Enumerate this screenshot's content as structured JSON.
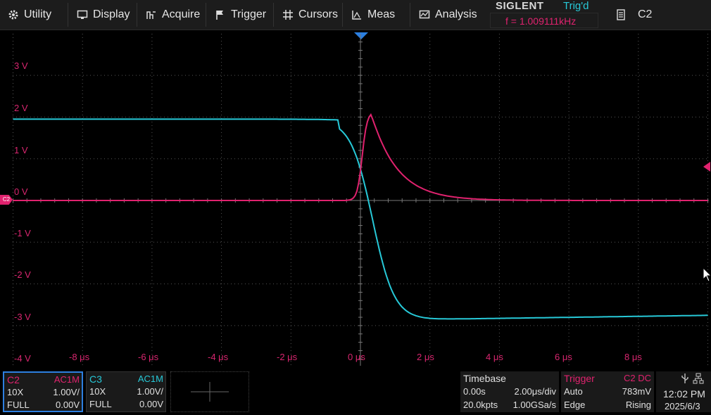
{
  "menu": {
    "items": [
      {
        "label": "Utility",
        "icon": "gear-icon"
      },
      {
        "label": "Display",
        "icon": "monitor-icon"
      },
      {
        "label": "Acquire",
        "icon": "acquire-icon"
      },
      {
        "label": "Trigger",
        "icon": "flag-icon"
      },
      {
        "label": "Cursors",
        "icon": "cursors-icon"
      },
      {
        "label": "Meas",
        "icon": "measure-icon"
      },
      {
        "label": "Analysis",
        "icon": "analysis-icon"
      }
    ],
    "brand": "SIGLENT",
    "trigger_status": "Trig'd",
    "frequency": "f = 1.009111kHz",
    "channel_menu": {
      "label": "C2",
      "icon": "document-icon"
    }
  },
  "display": {
    "colors": {
      "c2": "#e0226e",
      "c3": "#27c9d8",
      "grid": "#5a5a5a",
      "label": "#d8266f"
    },
    "voltage_labels": [
      "3 V",
      "2 V",
      "1 V",
      "0 V",
      "-1 V",
      "-2 V",
      "-3 V",
      "-4 V"
    ],
    "time_labels": [
      "-8 μs",
      "-6 μs",
      "-4 μs",
      "-2 μs",
      "0 μs",
      "2 μs",
      "4 μs",
      "6 μs",
      "8 μs"
    ],
    "channel_marker": "C2"
  },
  "channels": [
    {
      "name": "C2",
      "coupling": "AC1M",
      "probe": "10X",
      "scale": "1.00V/",
      "bandwidth": "FULL",
      "offset": "0.00V",
      "color": "#e0226e"
    },
    {
      "name": "C3",
      "coupling": "AC1M",
      "probe": "10X",
      "scale": "1.00V/",
      "bandwidth": "FULL",
      "offset": "0.00V",
      "color": "#27c9d8"
    }
  ],
  "timebase": {
    "title": "Timebase",
    "delay": "0.00s",
    "scale": "2.00μs/div",
    "memory": "20.0kpts",
    "sample_rate": "1.00GSa/s"
  },
  "trigger": {
    "title": "Trigger",
    "source": "C2",
    "coupling": "DC",
    "mode": "Auto",
    "level": "783mV",
    "type": "Edge",
    "slope": "Rising"
  },
  "clock": {
    "time": "12:02 PM",
    "date": "2025/6/3"
  }
}
